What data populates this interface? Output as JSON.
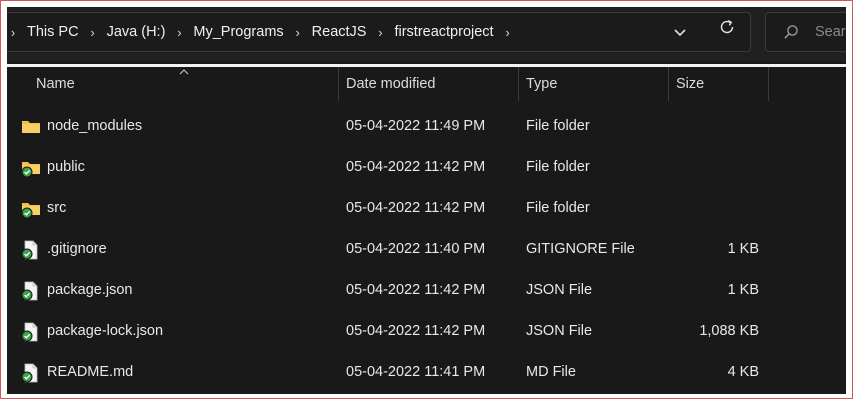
{
  "breadcrumb": {
    "items": [
      "This PC",
      "Java (H:)",
      "My_Programs",
      "ReactJS",
      "firstreactproject"
    ],
    "separator": "›"
  },
  "search": {
    "placeholder": "Search"
  },
  "columns": {
    "name": "Name",
    "date": "Date modified",
    "type": "Type",
    "size": "Size"
  },
  "files": [
    {
      "name": "node_modules",
      "date": "05-04-2022 11:49 PM",
      "type": "File folder",
      "size": "",
      "icon": "folder-icon"
    },
    {
      "name": "public",
      "date": "05-04-2022 11:42 PM",
      "type": "File folder",
      "size": "",
      "icon": "folder-synced-icon"
    },
    {
      "name": "src",
      "date": "05-04-2022 11:42 PM",
      "type": "File folder",
      "size": "",
      "icon": "folder-synced-icon"
    },
    {
      "name": ".gitignore",
      "date": "05-04-2022 11:40 PM",
      "type": "GITIGNORE File",
      "size": "1 KB",
      "icon": "file-synced-icon"
    },
    {
      "name": "package.json",
      "date": "05-04-2022 11:42 PM",
      "type": "JSON File",
      "size": "1 KB",
      "icon": "file-synced-icon"
    },
    {
      "name": "package-lock.json",
      "date": "05-04-2022 11:42 PM",
      "type": "JSON File",
      "size": "1,088 KB",
      "icon": "file-synced-icon"
    },
    {
      "name": "README.md",
      "date": "05-04-2022 11:41 PM",
      "type": "MD File",
      "size": "4 KB",
      "icon": "file-synced-icon"
    }
  ],
  "colors": {
    "background": "#191919",
    "folder": "#f5c04a",
    "sync_check": "#3aa34a",
    "frame_border": "#c9585f"
  }
}
